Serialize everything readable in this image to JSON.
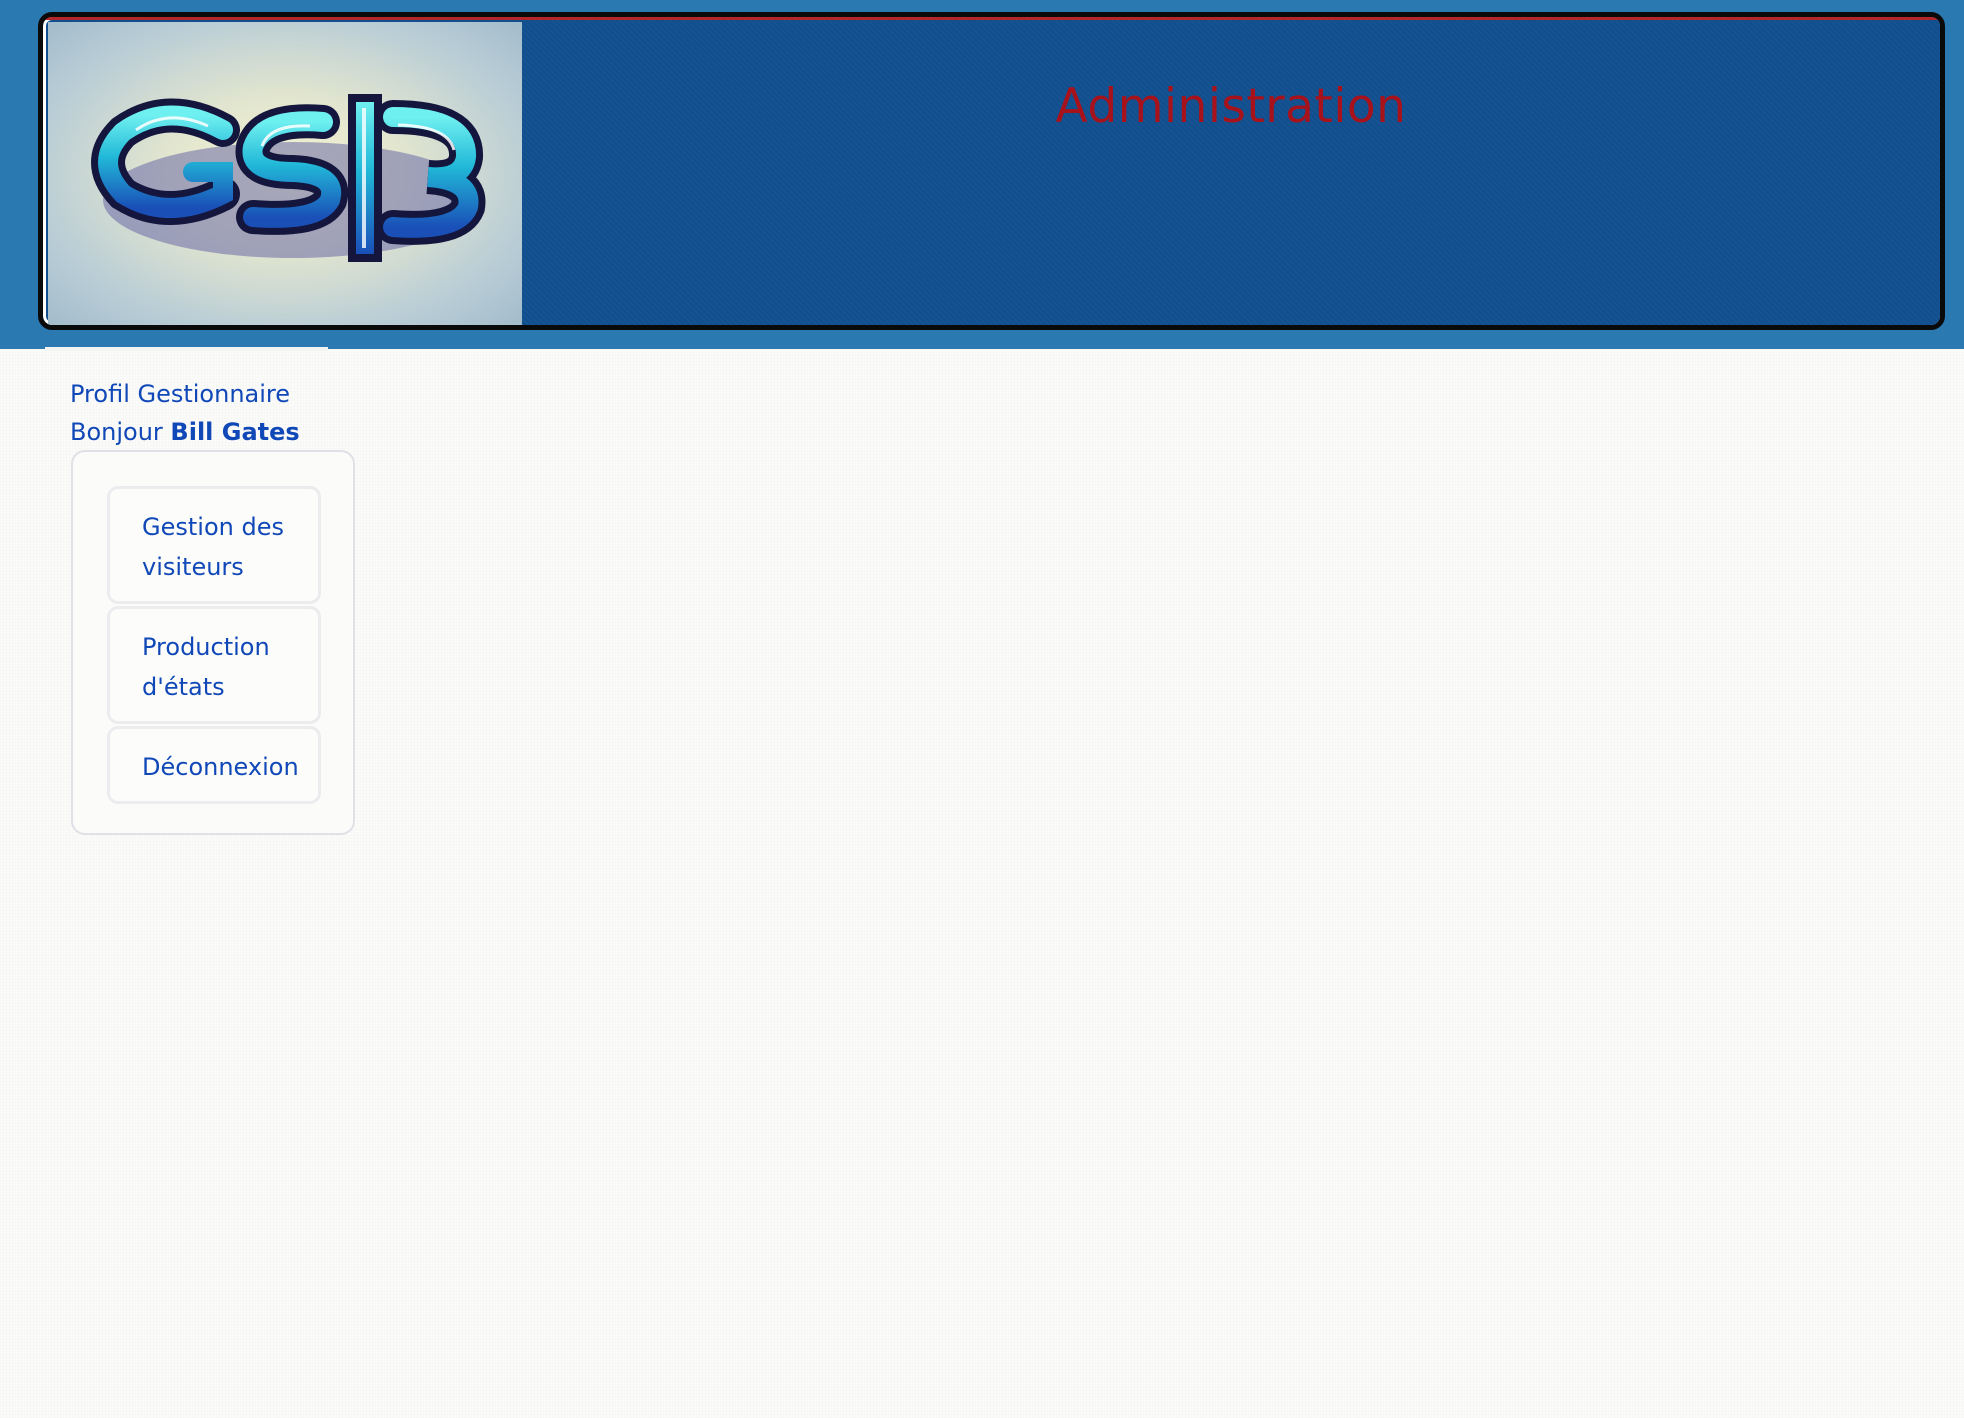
{
  "header": {
    "logo_text": "GSB",
    "title": "Administration"
  },
  "sidebar": {
    "profile": "Profil Gestionnaire",
    "greeting_prefix": "Bonjour ",
    "user_name": "Bill Gates",
    "menu": [
      {
        "label": "Gestion des visiteurs"
      },
      {
        "label": "Production d'états"
      },
      {
        "label": "Déconnexion"
      }
    ]
  },
  "colors": {
    "top_band": "#2a79b1",
    "header_bg": "#114f8f",
    "title_text": "#a8121a",
    "link_text": "#1148b8"
  }
}
